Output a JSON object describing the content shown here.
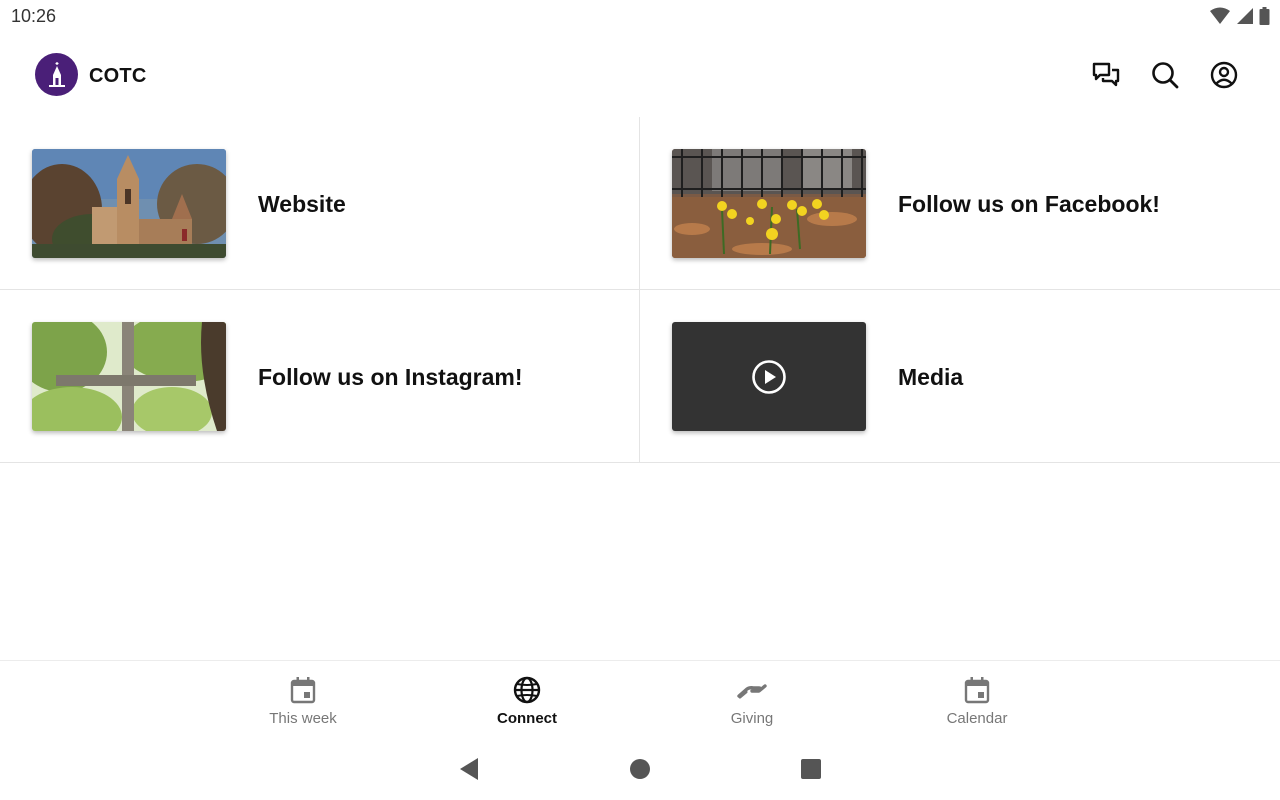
{
  "status_bar": {
    "time": "10:26",
    "icons": [
      "wifi-icon",
      "cell-signal-icon",
      "battery-icon"
    ]
  },
  "app_bar": {
    "title": "COTC",
    "logo": "church-logo",
    "actions": [
      "chat-icon",
      "search-icon",
      "account-icon"
    ]
  },
  "tiles": [
    {
      "label": "Website",
      "thumbnail": "stone church among autumn trees"
    },
    {
      "label": "Follow us on Facebook!",
      "thumbnail": "yellow daffodils by iron fence"
    },
    {
      "label": "Follow us on Instagram!",
      "thumbnail": "wooden cross among green trees"
    },
    {
      "label": "Media",
      "thumbnail": "play-icon"
    }
  ],
  "bottom_nav": {
    "items": [
      {
        "label": "This week",
        "icon": "calendar-icon",
        "active": false
      },
      {
        "label": "Connect",
        "icon": "globe-icon",
        "active": true
      },
      {
        "label": "Giving",
        "icon": "giving-hand-icon",
        "active": false
      },
      {
        "label": "Calendar",
        "icon": "calendar-icon",
        "active": false
      }
    ]
  },
  "system_nav": [
    "back-button",
    "home-button",
    "recents-button"
  ],
  "colors": {
    "brand": "#4a1f78",
    "media_tile": "#333333",
    "divider": "#e4e4e4",
    "active_nav": "#111111",
    "inactive_nav": "#777777"
  }
}
